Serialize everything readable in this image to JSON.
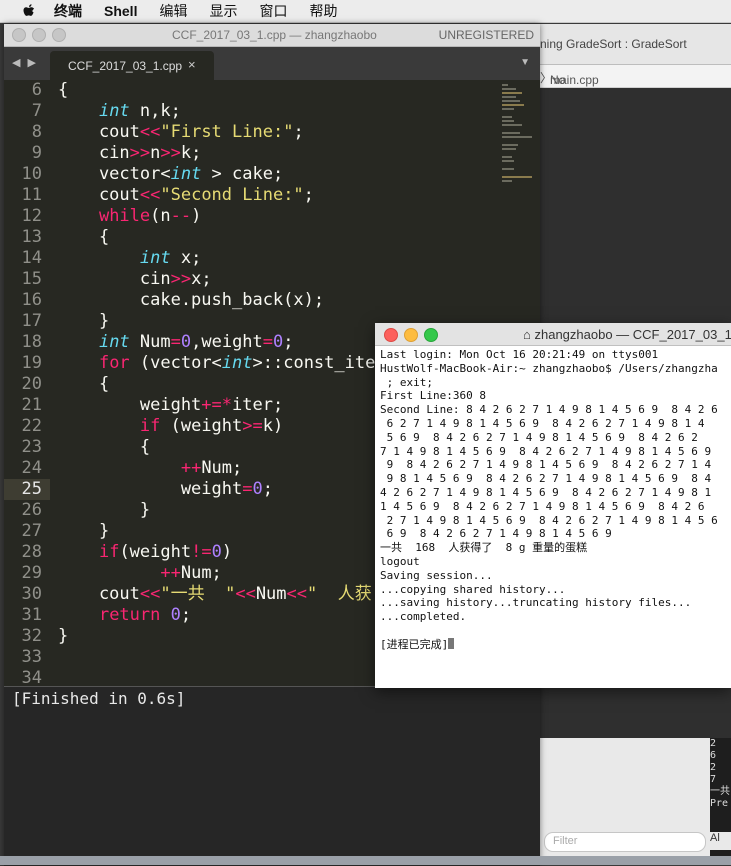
{
  "menubar": {
    "items": [
      "终端",
      "Shell",
      "编辑",
      "显示",
      "窗口",
      "帮助"
    ]
  },
  "xcode": {
    "title": "ning GradeSort : GradeSort",
    "jumpbar_file": "main.cpp",
    "jumpbar_selection": "No Selection",
    "filter_placeholder": "Filter",
    "console_lines": [
      "2",
      "6",
      "2",
      "7",
      "一共",
      "Pre"
    ],
    "all_label": "Al"
  },
  "sublime": {
    "title": "CCF_2017_03_1.cpp — zhangzhaobo",
    "unregistered": "UNREGISTERED",
    "tab_name": "CCF_2017_03_1.cpp",
    "current_line": 25,
    "line_numbers": [
      6,
      7,
      8,
      9,
      10,
      11,
      12,
      13,
      14,
      15,
      16,
      17,
      18,
      19,
      20,
      21,
      22,
      23,
      24,
      25,
      26,
      27,
      28,
      29,
      30,
      31,
      32,
      33,
      34
    ],
    "build_output": "[Finished in 0.6s]",
    "code_lines": [
      "{",
      "    int n,k;",
      "    cout<<\"First Line:\";",
      "    cin>>n>>k;",
      "    vector<int > cake;",
      "    cout<<\"Second Line:\";",
      "    while(n--)",
      "    {",
      "        int x;",
      "        cin>>x;",
      "        cake.push_back(x);",
      "    }",
      "    int Num=0,weight=0;",
      "    for (vector<int>::const_ite",
      "    {",
      "        weight+=*iter;",
      "        if (weight>=k)",
      "        {",
      "            ++Num;",
      "            weight=0;",
      "        }",
      "    }",
      "    if(weight!=0)",
      "          ++Num;",
      "    cout<<\"一共  \"<<Num<<\"  人获",
      "    return 0;",
      "}",
      "",
      ""
    ]
  },
  "terminal": {
    "title": "zhangzhaobo — CCF_2017_03_1",
    "lines": [
      "Last login: Mon Oct 16 20:21:49 on ttys001",
      "HustWolf-MacBook-Air:~ zhangzhaobo$ /Users/zhangzha",
      " ; exit;",
      "First Line:360 8",
      "Second Line: 8 4 2 6 2 7 1 4 9 8 1 4 5 6 9  8 4 2 6",
      " 6 2 7 1 4 9 8 1 4 5 6 9  8 4 2 6 2 7 1 4 9 8 1 4",
      " 5 6 9  8 4 2 6 2 7 1 4 9 8 1 4 5 6 9  8 4 2 6 2",
      "7 1 4 9 8 1 4 5 6 9  8 4 2 6 2 7 1 4 9 8 1 4 5 6 9",
      " 9  8 4 2 6 2 7 1 4 9 8 1 4 5 6 9  8 4 2 6 2 7 1 4",
      " 9 8 1 4 5 6 9  8 4 2 6 2 7 1 4 9 8 1 4 5 6 9  8 4",
      "4 2 6 2 7 1 4 9 8 1 4 5 6 9  8 4 2 6 2 7 1 4 9 8 1",
      "1 4 5 6 9  8 4 2 6 2 7 1 4 9 8 1 4 5 6 9  8 4 2 6",
      " 2 7 1 4 9 8 1 4 5 6 9  8 4 2 6 2 7 1 4 9 8 1 4 5 6",
      " 6 9  8 4 2 6 2 7 1 4 9 8 1 4 5 6 9",
      "一共  168  人获得了  8 g 重量的蛋糕",
      "logout",
      "Saving session...",
      "...copying shared history...",
      "...saving history...truncating history files...",
      "...completed.",
      "",
      "[进程已完成]"
    ]
  },
  "colors": {
    "editor_bg": "#272822",
    "keyword": "#f92672",
    "type": "#66d9ef",
    "string": "#e6db74",
    "number": "#ae81ff",
    "close_red": "#fc605c",
    "minimize_yellow": "#fdbc40",
    "zoom_green": "#34c84a"
  }
}
